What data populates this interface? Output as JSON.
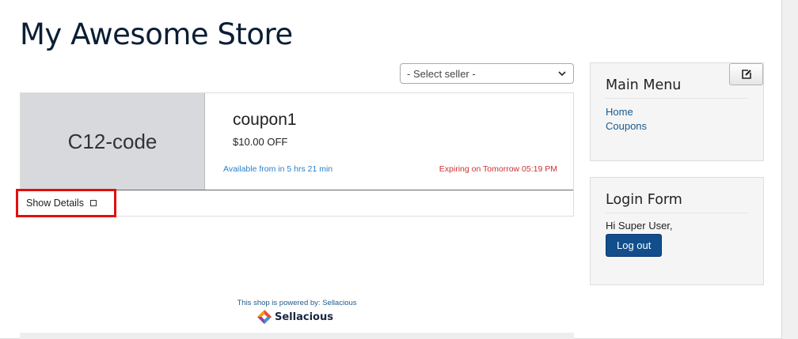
{
  "site": {
    "title": "My Awesome Store"
  },
  "filter": {
    "seller_select": "- Select seller -"
  },
  "coupon": {
    "code": "C12-code",
    "title": "coupon1",
    "amount": "$10.00 OFF",
    "available": "Available from in 5 hrs 21 min",
    "expiry": "Expiring on Tomorrow 05:19 PM",
    "show_details": "Show Details"
  },
  "footer": {
    "powered_by": "This shop is powered by: Sellacious",
    "brand": "Sellacious"
  },
  "main_menu": {
    "title": "Main Menu",
    "items": [
      {
        "label": "Home"
      },
      {
        "label": "Coupons"
      }
    ]
  },
  "login": {
    "title": "Login Form",
    "greeting": "Hi Super User,",
    "logout_label": "Log out"
  },
  "colors": {
    "title": "#0b1e35",
    "link": "#175a8e",
    "available": "#2a7fc9",
    "expiry": "#cc3333",
    "highlight": "#e01010",
    "button": "#124e8c"
  }
}
